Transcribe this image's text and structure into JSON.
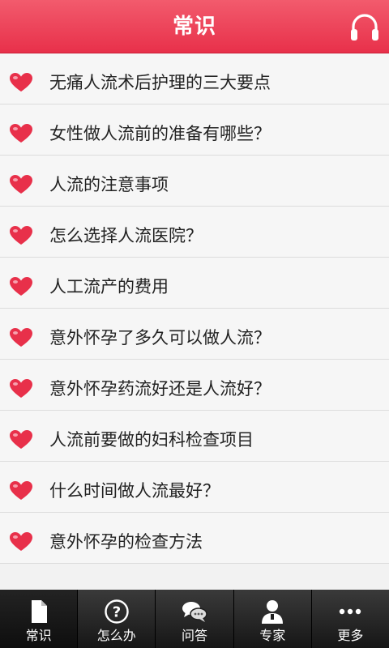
{
  "header": {
    "title": "常识",
    "headphones_icon": "headphones-icon"
  },
  "colors": {
    "accent": "#e8304a",
    "heart": "#e8304a",
    "tabbar_bg": "#1e1e1e"
  },
  "list": {
    "items": [
      {
        "label": "无痛人流术后护理的三大要点",
        "icon": "heart-icon"
      },
      {
        "label": "女性做人流前的准备有哪些？",
        "icon": "heart-icon"
      },
      {
        "label": "人流的注意事项",
        "icon": "heart-icon"
      },
      {
        "label": "怎么选择人流医院？",
        "icon": "heart-icon"
      },
      {
        "label": "人工流产的费用",
        "icon": "heart-icon"
      },
      {
        "label": "意外怀孕了多久可以做人流？",
        "icon": "heart-icon"
      },
      {
        "label": "意外怀孕药流好还是人流好？",
        "icon": "heart-icon"
      },
      {
        "label": "人流前要做的妇科检查项目",
        "icon": "heart-icon"
      },
      {
        "label": "什么时间做人流最好？",
        "icon": "heart-icon"
      },
      {
        "label": "意外怀孕的检查方法",
        "icon": "heart-icon"
      }
    ]
  },
  "tabbar": {
    "active": 0,
    "tabs": [
      {
        "label": "常识",
        "icon": "document-icon"
      },
      {
        "label": "怎么办",
        "icon": "question-icon"
      },
      {
        "label": "问答",
        "icon": "chat-icon"
      },
      {
        "label": "专家",
        "icon": "doctor-icon"
      },
      {
        "label": "更多",
        "icon": "more-icon"
      }
    ]
  }
}
